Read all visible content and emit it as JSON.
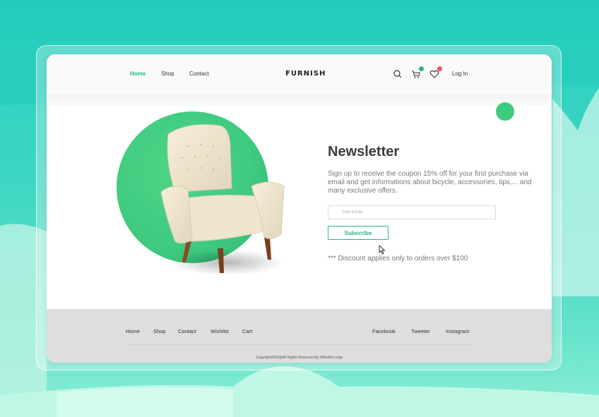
{
  "header": {
    "nav": [
      {
        "label": "Home",
        "active": true
      },
      {
        "label": "Shop",
        "active": false
      },
      {
        "label": "Contact",
        "active": false
      }
    ],
    "logo": "FURNISH",
    "icons": {
      "search": "search-icon",
      "cart": "cart-icon",
      "wishlist": "heart-icon"
    },
    "cart_badge_color": "#2ab67d",
    "wishlist_badge_color": "#ef4b6e",
    "login_label": "Log In"
  },
  "newsletter": {
    "title": "Newsletter",
    "description": "Sign up to receive the coupon 15% off for your first purchase via email and get informations about bicycle, accessories, tips,... and many exclusive offers.",
    "email_placeholder": "Your Email",
    "subscribe_label": "Subscribe",
    "discount_note": "*** Discount applies only to orders over $100"
  },
  "footer": {
    "links": [
      "Home",
      "Shop",
      "Contact",
      "Wishlist",
      "Cart"
    ],
    "social": [
      "Facebook",
      "Tweeter",
      "Instagram"
    ],
    "copyright": "Copyright2020@All Rights Reserved By //WinArtz.ninja"
  },
  "colors": {
    "accent": "#2ab67d",
    "hero_circle": "#3fcb80",
    "background": "#27cdbf"
  }
}
